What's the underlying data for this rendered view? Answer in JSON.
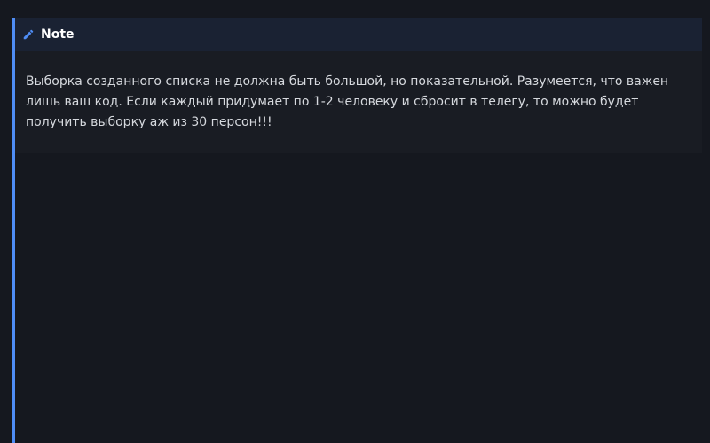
{
  "note": {
    "title": "Note",
    "icon": "pencil-icon",
    "accent_color": "#4f8df5",
    "body": "Выборка созданного списка не должна быть большой, но показательной. Разумеется, что важен лишь ваш код. Если каждый придумает по 1-2 человеку и сбросит в телегу, то можно будет получить выборку аж из 30 персон!!!"
  }
}
